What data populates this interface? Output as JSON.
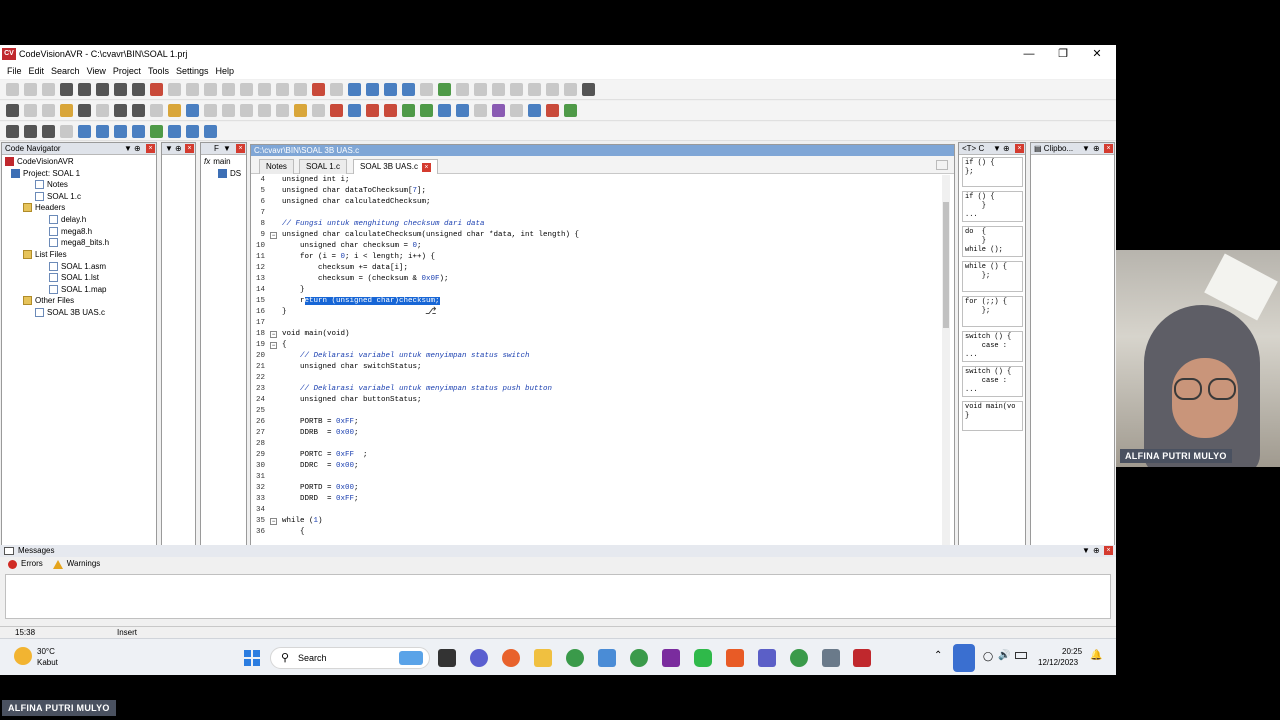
{
  "window": {
    "title": "CodeVisionAVR - C:\\cvavr\\BIN\\SOAL 1.prj",
    "logo_text": "CV"
  },
  "menu": [
    "File",
    "Edit",
    "Search",
    "View",
    "Project",
    "Tools",
    "Settings",
    "Help"
  ],
  "navigator": {
    "title": "Code Navigator",
    "items": [
      {
        "label": "CodeVisionAVR",
        "icon": "cv-logo"
      },
      {
        "label": "Project: SOAL 1",
        "icon": "project"
      },
      {
        "label": "Notes",
        "icon": "file"
      },
      {
        "label": "SOAL 1.c",
        "icon": "file"
      },
      {
        "label": "Headers",
        "icon": "folder"
      },
      {
        "label": "delay.h",
        "icon": "file"
      },
      {
        "label": "mega8.h",
        "icon": "file"
      },
      {
        "label": "mega8_bits.h",
        "icon": "file"
      },
      {
        "label": "List Files",
        "icon": "folder"
      },
      {
        "label": "SOAL 1.asm",
        "icon": "file"
      },
      {
        "label": "SOAL 1.lst",
        "icon": "file"
      },
      {
        "label": "SOAL 1.map",
        "icon": "file"
      },
      {
        "label": "Other Files",
        "icon": "folder"
      },
      {
        "label": "SOAL 3B UAS.c",
        "icon": "file"
      }
    ]
  },
  "function_panel": {
    "title": "F",
    "items": [
      "main",
      "DS"
    ]
  },
  "editor": {
    "path": "C:\\cvavr\\BIN\\SOAL 3B UAS.c",
    "tabs": [
      "Notes",
      "SOAL 1.c",
      "SOAL 3B UAS.c"
    ],
    "lines": [
      {
        "n": "4",
        "text": "unsigned int i;"
      },
      {
        "n": "5",
        "text": "unsigned char dataToChecksum[7];"
      },
      {
        "n": "6",
        "text": "unsigned char calculatedChecksum;"
      },
      {
        "n": "7",
        "text": ""
      },
      {
        "n": "8",
        "text": "// Fungsi untuk menghitung checksum dari data",
        "style": "comment"
      },
      {
        "n": "9",
        "text": "unsigned char calculateChecksum(unsigned char *data, int length) {"
      },
      {
        "n": "10",
        "text": "    unsigned char checksum = 0;"
      },
      {
        "n": "11",
        "text": "    for (i = 0; i < length; i++) {"
      },
      {
        "n": "12",
        "text": "        checksum += data[i];"
      },
      {
        "n": "13",
        "text": "        checksum = (checksum & 0x0F);"
      },
      {
        "n": "14",
        "text": "    }"
      },
      {
        "n": "15",
        "text": "    return (unsigned char)checksum;",
        "selection_start": "eturn (unsigned char)checksum;"
      },
      {
        "n": "16",
        "text": "}"
      },
      {
        "n": "17",
        "text": ""
      },
      {
        "n": "18",
        "text": "void main(void)"
      },
      {
        "n": "19",
        "text": "{"
      },
      {
        "n": "20",
        "text": "    // Deklarasi variabel untuk menyimpan status switch",
        "style": "comment"
      },
      {
        "n": "21",
        "text": "    unsigned char switchStatus;"
      },
      {
        "n": "22",
        "text": ""
      },
      {
        "n": "23",
        "text": "    // Deklarasi variabel untuk menyimpan status push button",
        "style": "comment"
      },
      {
        "n": "24",
        "text": "    unsigned char buttonStatus;"
      },
      {
        "n": "25",
        "text": ""
      },
      {
        "n": "26",
        "text": "    PORTB = 0xFF;"
      },
      {
        "n": "27",
        "text": "    DDRB  = 0x00;"
      },
      {
        "n": "28",
        "text": ""
      },
      {
        "n": "29",
        "text": "    PORTC = 0xFF  ;"
      },
      {
        "n": "30",
        "text": "    DDRC  = 0x00;"
      },
      {
        "n": "31",
        "text": ""
      },
      {
        "n": "32",
        "text": "    PORTD = 0x00;"
      },
      {
        "n": "33",
        "text": "    DDRD  = 0xFF;"
      },
      {
        "n": "34",
        "text": ""
      },
      {
        "n": "35",
        "text": "while (1)"
      },
      {
        "n": "36",
        "text": "    {"
      }
    ]
  },
  "templates": {
    "title": "C",
    "items": [
      "if () {\n};",
      "if () {\n    }\n...",
      "do  {\n    }\nwhile ();",
      "while () {\n    };",
      "for (;;) {\n    };",
      "switch () {\n    case :\n...",
      "switch () {\n    case :\n...",
      "void main(vo\n}"
    ]
  },
  "clipboard": {
    "title": "Clipbo..."
  },
  "messages": {
    "title": "Messages",
    "tabs": [
      "Errors",
      "Warnings"
    ]
  },
  "status": {
    "position": "15:38",
    "mode": "Insert"
  },
  "taskbar": {
    "weather_temp": "30°C",
    "weather_desc": "Kabut",
    "search_label": "Search",
    "time": "20:25",
    "date": "12/12/2023"
  },
  "webcam": {
    "name": "ALFINA PUTRI MULYO"
  },
  "participant_label": "ALFINA PUTRI MULYO"
}
